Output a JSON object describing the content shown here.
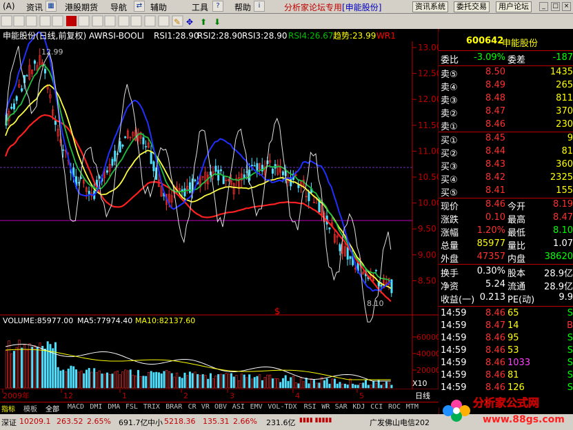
{
  "menu": {
    "items": [
      "(A)",
      "资讯",
      "港股期货",
      "导航",
      "辅助",
      "工具",
      "帮助"
    ],
    "forum_label": "分析家论坛专用",
    "forum_stock": "[申能股份]",
    "buttons": [
      "资讯系统",
      "委托交易",
      "用户论坛"
    ]
  },
  "chart": {
    "title": "申能股份(日线,前复权) AWRSI-BOOLI",
    "rsi": [
      "RSI1:28.90",
      "RSI2:28.90",
      "RSI3:28.90",
      "RSI4:26.67",
      "趋势:23.99",
      "WR1"
    ],
    "price_labels": [
      "13.00",
      "12.50",
      "12.00",
      "11.50",
      "11.00",
      "10.50",
      "10.00",
      "9.50",
      "9.00",
      "8.50"
    ],
    "high_label": "12.99",
    "low_label": "8.10",
    "signal_mark": "$",
    "volume_title": "VOLUME:85977.00",
    "ma5": "MA5:77974.40",
    "ma10": "MA10:82137.60",
    "volume_labels": [
      "60000",
      "40000",
      "20000"
    ],
    "vol_unit": "X10",
    "x_labels": [
      "2009年",
      "12",
      "1",
      "2",
      "3",
      "4",
      "5"
    ],
    "period": "日线"
  },
  "panel": {
    "code": "600642",
    "name": "申能股份",
    "weibi_label": "委比",
    "weibi": "-3.09%",
    "weicha_label": "委差",
    "weicha": "-187",
    "sell": [
      {
        "l": "卖⑤",
        "p": "8.50",
        "v": "1435"
      },
      {
        "l": "卖④",
        "p": "8.49",
        "v": "265"
      },
      {
        "l": "卖③",
        "p": "8.48",
        "v": "811"
      },
      {
        "l": "卖②",
        "p": "8.47",
        "v": "370"
      },
      {
        "l": "卖①",
        "p": "8.46",
        "v": "230"
      }
    ],
    "buy": [
      {
        "l": "买①",
        "p": "8.45",
        "v": "9"
      },
      {
        "l": "买②",
        "p": "8.44",
        "v": "81"
      },
      {
        "l": "买③",
        "p": "8.43",
        "v": "360"
      },
      {
        "l": "买④",
        "p": "8.42",
        "v": "2325"
      },
      {
        "l": "买⑤",
        "p": "8.41",
        "v": "155"
      }
    ],
    "stats": [
      {
        "a": "现价",
        "b": "8.46",
        "c": "今开",
        "d": "8.19"
      },
      {
        "a": "涨跌",
        "b": "0.10",
        "c": "最高",
        "d": "8.47"
      },
      {
        "a": "涨幅",
        "b": "1.20%",
        "c": "最低",
        "d": "8.10"
      },
      {
        "a": "总量",
        "b": "85977",
        "c": "量比",
        "d": "1.07"
      },
      {
        "a": "外盘",
        "b": "47357",
        "c": "内盘",
        "d": "38620"
      }
    ],
    "fin": [
      {
        "a": "换手",
        "b": "0.30%",
        "c": "股本",
        "d": "28.9亿"
      },
      {
        "a": "净资",
        "b": "5.24",
        "c": "流通",
        "d": "28.9亿"
      },
      {
        "a": "收益(一)",
        "b": "0.213",
        "c": "PE(动)",
        "d": "9.9"
      }
    ],
    "ticks": [
      {
        "t": "14:59",
        "p": "8.46",
        "v": "65",
        "s": "S"
      },
      {
        "t": "14:59",
        "p": "8.47",
        "v": "14",
        "s": "B"
      },
      {
        "t": "14:59",
        "p": "8.46",
        "v": "95",
        "s": "S"
      },
      {
        "t": "14:59",
        "p": "8.46",
        "v": "53",
        "s": "S"
      },
      {
        "t": "14:59",
        "p": "8.46",
        "v": "1033",
        "s": "S"
      },
      {
        "t": "14:59",
        "p": "8.46",
        "v": "81",
        "s": "S"
      },
      {
        "t": "14:59",
        "p": "8.46",
        "v": "126",
        "s": "S"
      }
    ]
  },
  "tabs": [
    "指标",
    "模板",
    "全部",
    "MACD",
    "DMI",
    "DMA",
    "FSL",
    "TRIX",
    "BRAR",
    "CR",
    "VR",
    "OBV",
    "ASI",
    "EMV",
    "VOL-TDX",
    "RSI",
    "WR",
    "SAR",
    "KDJ",
    "CCI",
    "ROC",
    "MTM"
  ],
  "status": {
    "sz": "深证",
    "sz_val": "10209.1",
    "sz_chg": "263.52",
    "sz_pct": "2.65%",
    "sz_amt": "691.7亿",
    "zx": "中小",
    "zx_val": "5218.36",
    "zx_chg": "135.31",
    "zx_pct": "2.66%",
    "zx_amt": "231.6亿",
    "news": "广发佛山电信202"
  },
  "watermark": {
    "title": "分析家公式网",
    "url": "www.88gs.com"
  }
}
